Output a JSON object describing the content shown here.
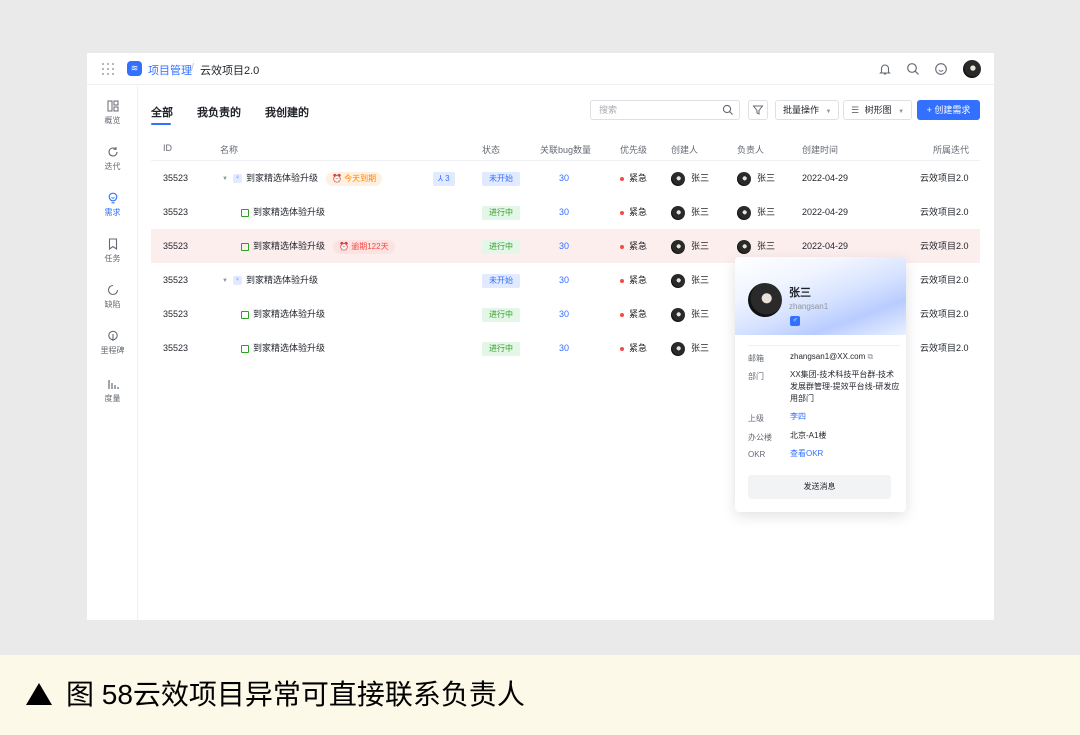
{
  "topbar": {
    "logo_glyph": "≋",
    "breadcrumb": [
      "项目管理",
      "云效项目2.0"
    ],
    "separator": "/"
  },
  "sidebar": {
    "items": [
      {
        "label": "概览",
        "icon": "overview-icon",
        "active": false
      },
      {
        "label": "迭代",
        "icon": "iteration-icon",
        "active": false
      },
      {
        "label": "需求",
        "icon": "requirement-icon",
        "active": true
      },
      {
        "label": "任务",
        "icon": "task-icon",
        "active": false
      },
      {
        "label": "缺陷",
        "icon": "defect-icon",
        "active": false
      },
      {
        "label": "里程碑",
        "icon": "milestone-icon",
        "active": false
      },
      {
        "label": "度量",
        "icon": "metrics-icon",
        "active": false
      }
    ]
  },
  "tabs": [
    "全部",
    "我负责的",
    "我创建的"
  ],
  "toolbar": {
    "search_placeholder": "搜索",
    "bulk_label": "批量操作",
    "tree_label": "树形图",
    "create_label": "+ 创建需求"
  },
  "table": {
    "headers": [
      "ID",
      "名称",
      "状态",
      "关联bug数量",
      "优先级",
      "创建人",
      "负责人",
      "创建时间",
      "所属迭代"
    ],
    "rows": [
      {
        "id": "35523",
        "name": "到家精选体验升级",
        "type": "epic",
        "tag": "今天到期",
        "tag_kind": "orange",
        "sub_count": "3",
        "status": "未开始",
        "status_kind": "todo",
        "bugs": "30",
        "priority": "紧急",
        "creator": "张三",
        "owner": "张三",
        "date": "2022-04-29",
        "iteration": "云效项目2.0"
      },
      {
        "id": "35523",
        "name": "到家精选体验升级",
        "type": "child",
        "status": "进行中",
        "status_kind": "doing",
        "bugs": "30",
        "priority": "紧急",
        "creator": "张三",
        "owner": "张三",
        "date": "2022-04-29",
        "iteration": "云效项目2.0"
      },
      {
        "id": "35523",
        "name": "到家精选体验升级",
        "type": "child",
        "tag": "逾期122天",
        "tag_kind": "red",
        "status": "进行中",
        "status_kind": "doing",
        "bugs": "30",
        "priority": "紧急",
        "creator": "张三",
        "owner": "张三",
        "date": "2022-04-29",
        "iteration": "云效项目2.0",
        "highlight": true
      },
      {
        "id": "35523",
        "name": "到家精选体验升级",
        "type": "epic",
        "status": "未开始",
        "status_kind": "todo",
        "bugs": "30",
        "priority": "紧急",
        "creator": "张三",
        "iteration": "云效项目2.0"
      },
      {
        "id": "35523",
        "name": "到家精选体验升级",
        "type": "child",
        "status": "进行中",
        "status_kind": "doing",
        "bugs": "30",
        "priority": "紧急",
        "creator": "张三",
        "iteration": "云效项目2.0"
      },
      {
        "id": "35523",
        "name": "到家精选体验升级",
        "type": "child",
        "status": "进行中",
        "status_kind": "doing",
        "bugs": "30",
        "priority": "紧急",
        "creator": "张三",
        "iteration": "云效项目2.0"
      }
    ]
  },
  "profile_card": {
    "name": "张三",
    "username": "zhangsan1",
    "gender_glyph": "♂",
    "fields": [
      {
        "label": "邮箱",
        "value": "zhangsan1@XX.com",
        "link": false
      },
      {
        "label": "部门",
        "value": "XX集团-技术科技平台群-技术发展群管理-提效平台线-研发应用部门",
        "link": false
      },
      {
        "label": "上级",
        "value": "李四",
        "link": true
      },
      {
        "label": "办公楼",
        "value": "北京-A1楼",
        "link": false
      },
      {
        "label": "OKR",
        "value": "查看OKR",
        "link": true
      }
    ],
    "send_label": "发送消息"
  },
  "caption": "图 58云效项目异常可直接联系负责人",
  "colors": {
    "accent": "#3370ff",
    "danger": "#f54a45",
    "success": "#2ea121",
    "warning": "#ff8800"
  }
}
